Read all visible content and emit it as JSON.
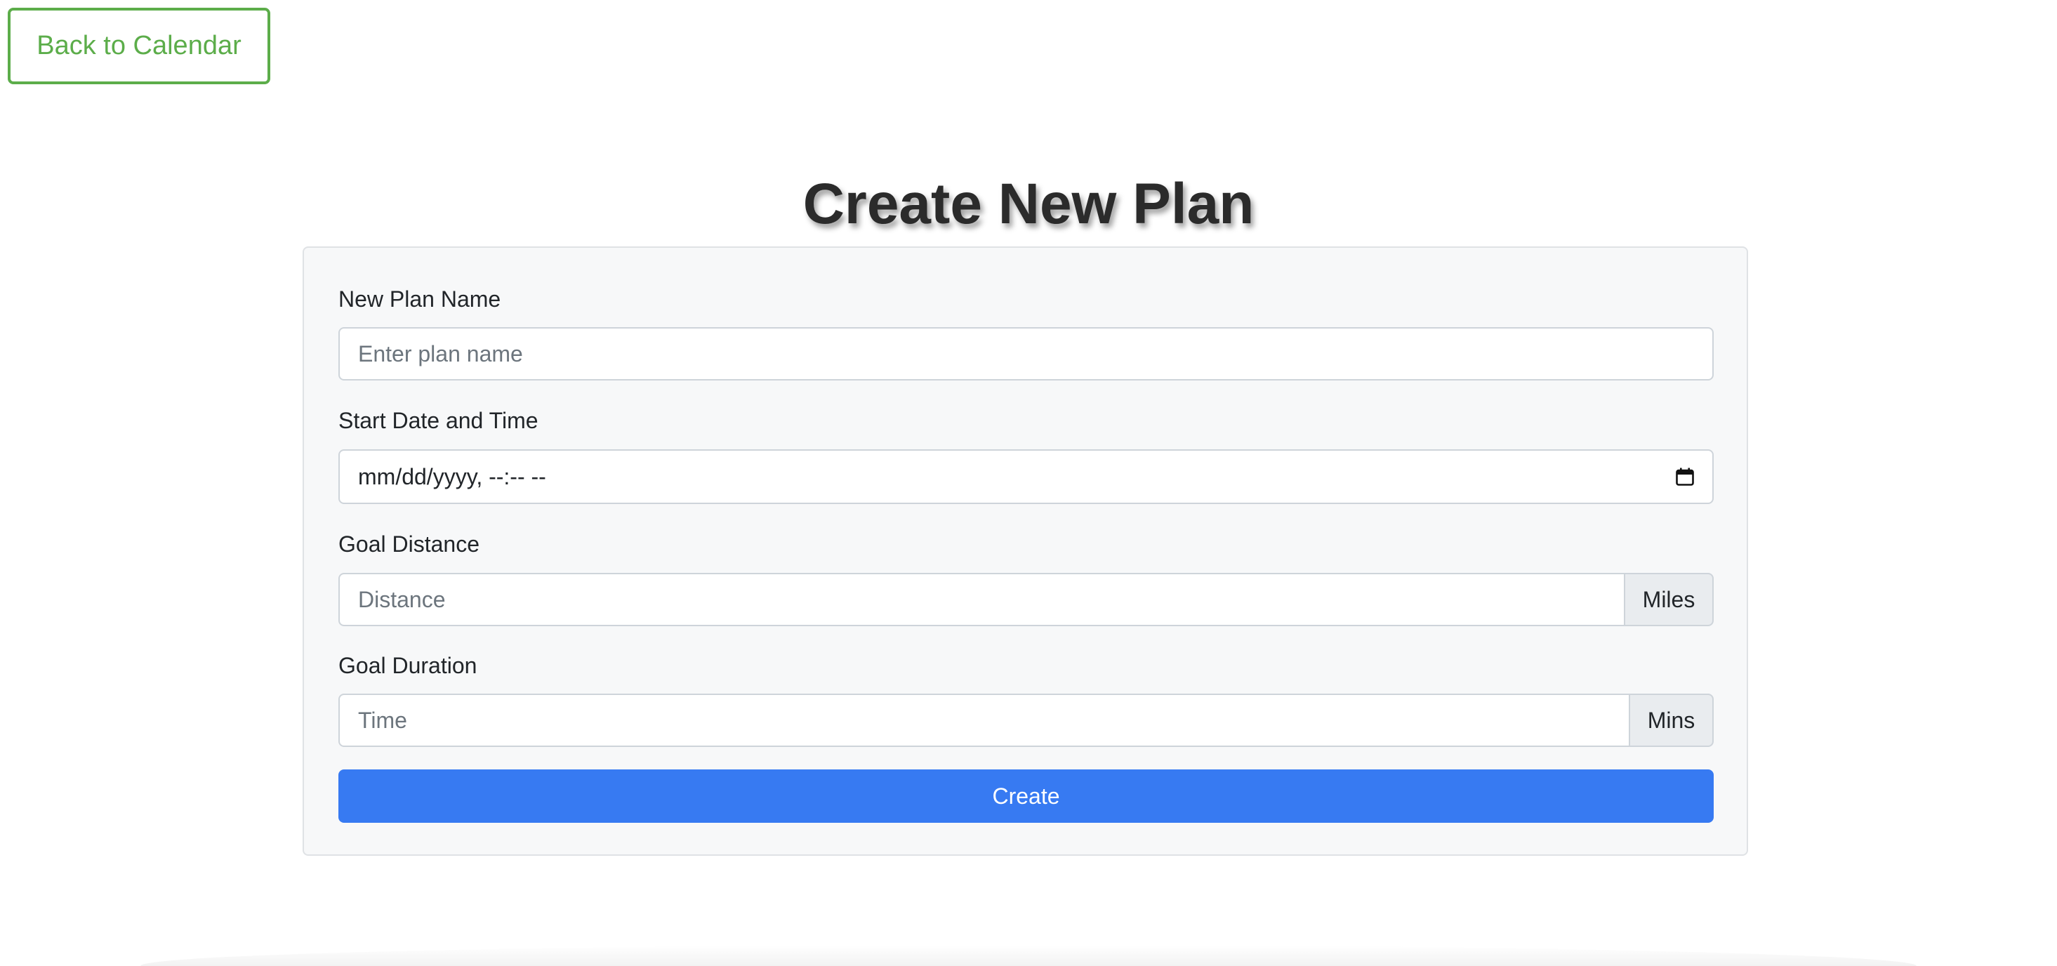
{
  "nav": {
    "back_label": "Back to Calendar"
  },
  "page": {
    "title": "Create New Plan"
  },
  "form": {
    "plan_name": {
      "label": "New Plan Name",
      "value": "",
      "placeholder": "Enter plan name"
    },
    "start": {
      "label": "Start Date and Time",
      "value": "mm/dd/yyyy, --:-- --",
      "icon": "calendar-icon"
    },
    "distance": {
      "label": "Goal Distance",
      "value": "",
      "placeholder": "Distance",
      "unit": "Miles"
    },
    "duration": {
      "label": "Goal Duration",
      "value": "",
      "placeholder": "Time",
      "unit": "Mins"
    },
    "submit_label": "Create"
  },
  "colors": {
    "accent_green": "#5cad4a",
    "primary_blue": "#377af2",
    "card_bg": "#f7f8f9",
    "addon_bg": "#e9ecef"
  }
}
